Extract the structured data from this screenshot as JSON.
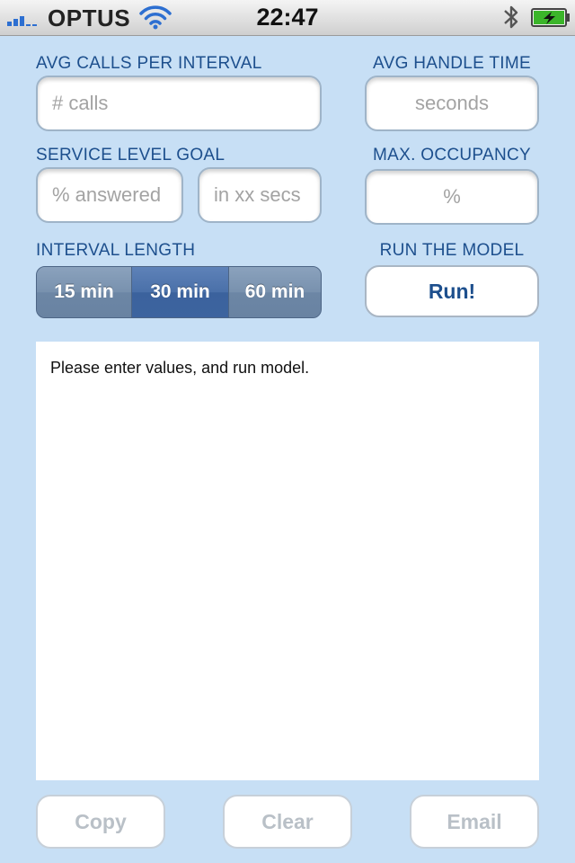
{
  "status_bar": {
    "carrier": "OPTUS",
    "time": "22:47",
    "icons": [
      "signal-icon",
      "wifi-icon",
      "bluetooth-icon",
      "battery-charging-icon"
    ]
  },
  "form": {
    "avg_calls": {
      "label": "AVG CALLS PER INTERVAL",
      "value": "",
      "placeholder": "# calls"
    },
    "avg_handle_time": {
      "label": "AVG HANDLE TIME",
      "value": "",
      "placeholder": "seconds"
    },
    "service_level": {
      "label": "SERVICE LEVEL GOAL",
      "percent_placeholder": "% answered",
      "percent_value": "",
      "secs_placeholder": "in xx secs",
      "secs_value": ""
    },
    "max_occupancy": {
      "label": "MAX. OCCUPANCY",
      "value": "",
      "placeholder": "%"
    },
    "interval_length": {
      "label": "INTERVAL LENGTH",
      "options": [
        "15 min",
        "30 min",
        "60 min"
      ],
      "selected": "30 min"
    },
    "run": {
      "label": "RUN THE MODEL",
      "button_label": "Run!"
    }
  },
  "results": {
    "text": "Please enter values, and run model."
  },
  "actions": {
    "copy_label": "Copy",
    "clear_label": "Clear",
    "email_label": "Email"
  },
  "colors": {
    "background": "#c7dff5",
    "label_text": "#1d4f8d",
    "segment_selected": "#3d649f",
    "segment_normal": "#7891ae",
    "disabled_button_text": "#b9c0c7"
  }
}
